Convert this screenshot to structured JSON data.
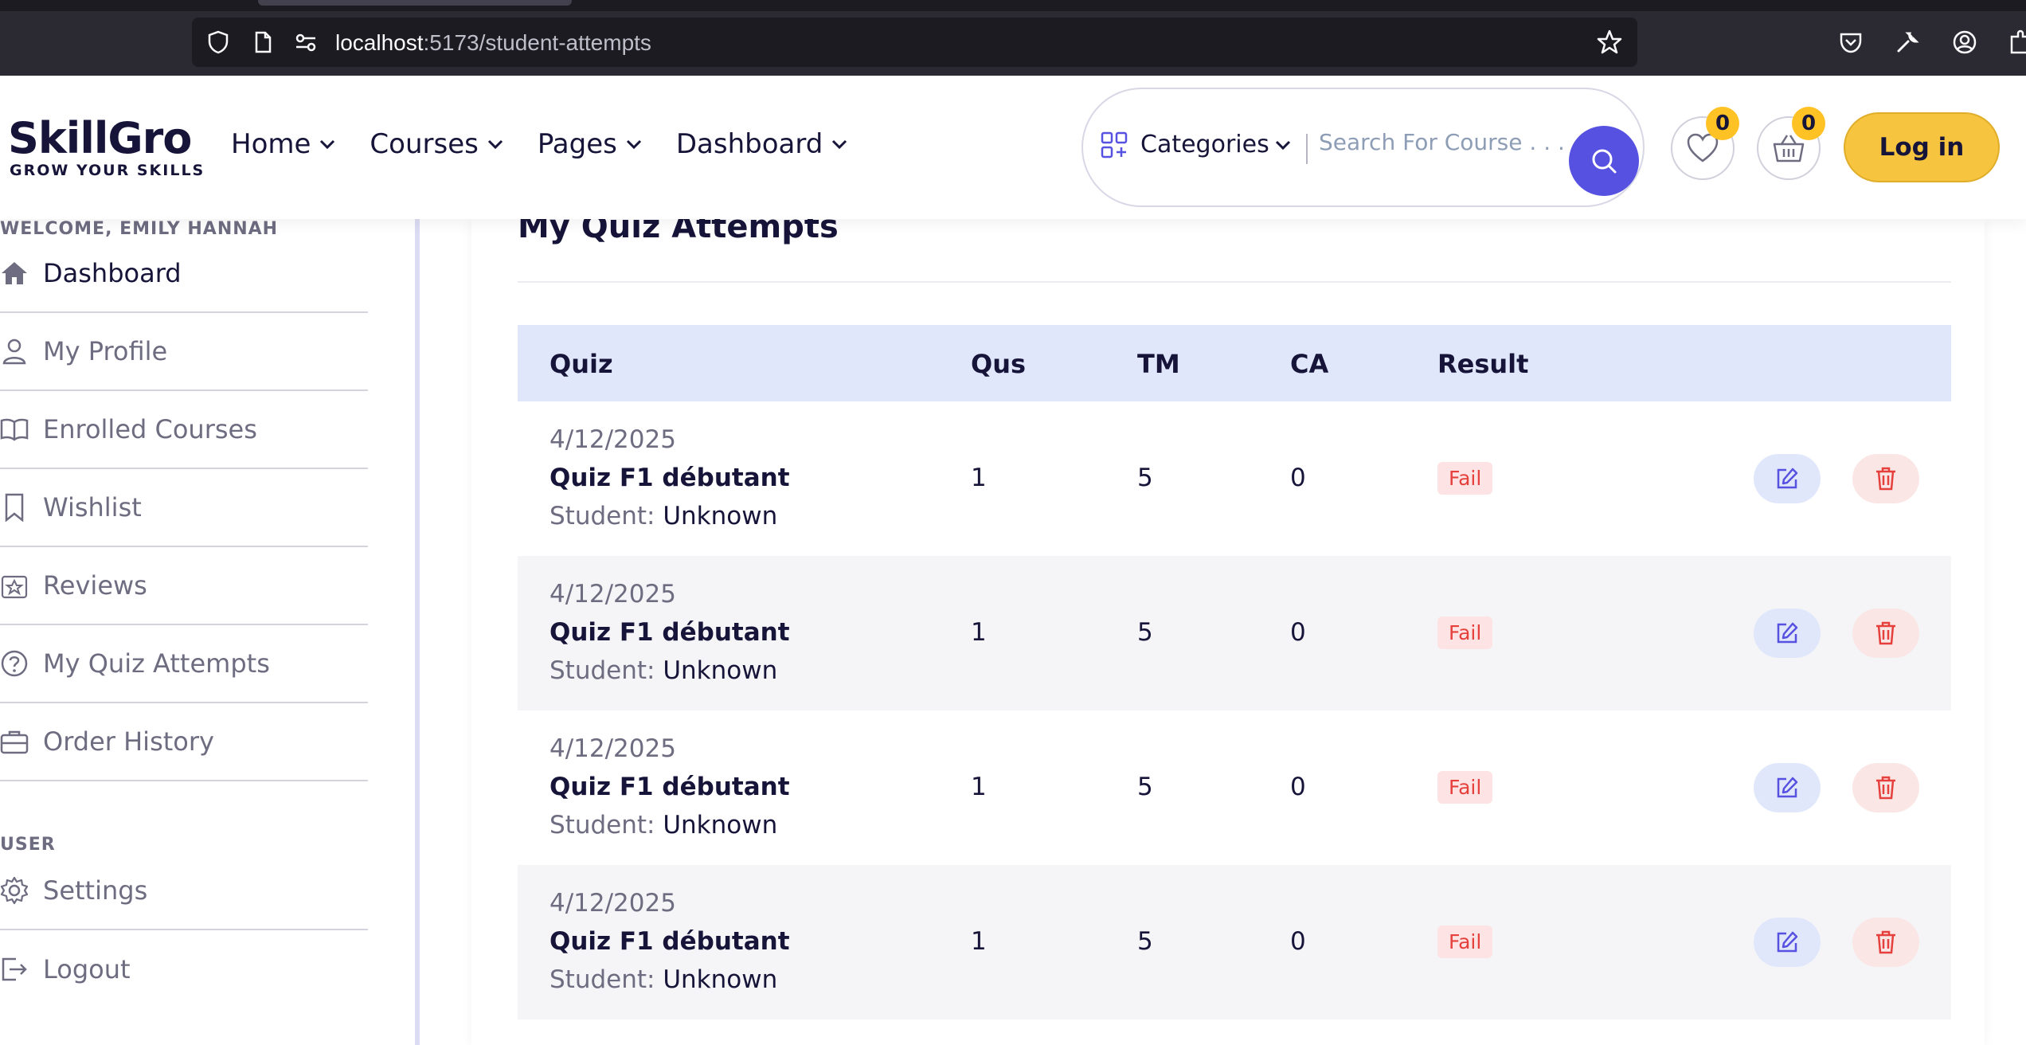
{
  "browser": {
    "url_host": "localhost",
    "url_path": ":5173/student-attempts"
  },
  "header": {
    "logo_text": "SkillGro",
    "logo_tagline": "GROW YOUR SKILLS",
    "nav": [
      {
        "label": "Home"
      },
      {
        "label": "Courses"
      },
      {
        "label": "Pages"
      },
      {
        "label": "Dashboard"
      }
    ],
    "categories_label": "Categories",
    "search_placeholder": "Search For Course . . .",
    "wishlist_count": "0",
    "cart_count": "0",
    "login_label": "Log in",
    "accent_color": "#5751e1",
    "login_color": "#f6c43e"
  },
  "sidebar": {
    "welcome": "WELCOME, EMILY HANNAH",
    "items": [
      {
        "label": "Dashboard",
        "icon": "home-icon"
      },
      {
        "label": "My Profile",
        "icon": "user-icon"
      },
      {
        "label": "Enrolled Courses",
        "icon": "book-icon"
      },
      {
        "label": "Wishlist",
        "icon": "bookmark-icon"
      },
      {
        "label": "Reviews",
        "icon": "star-icon"
      },
      {
        "label": "My Quiz Attempts",
        "icon": "question-icon"
      },
      {
        "label": "Order History",
        "icon": "briefcase-icon"
      }
    ],
    "user_heading": "USER",
    "user_items": [
      {
        "label": "Settings",
        "icon": "gear-icon"
      },
      {
        "label": "Logout",
        "icon": "logout-icon"
      }
    ]
  },
  "main": {
    "title": "My Quiz Attempts",
    "columns": {
      "quiz": "Quiz",
      "qus": "Qus",
      "tm": "TM",
      "ca": "CA",
      "result": "Result"
    },
    "student_label": "Student:",
    "rows": [
      {
        "date": "4/12/2025",
        "quiz": "Quiz F1 débutant",
        "student": "Unknown",
        "qus": "1",
        "tm": "5",
        "ca": "0",
        "result": "Fail"
      },
      {
        "date": "4/12/2025",
        "quiz": "Quiz F1 débutant",
        "student": "Unknown",
        "qus": "1",
        "tm": "5",
        "ca": "0",
        "result": "Fail"
      },
      {
        "date": "4/12/2025",
        "quiz": "Quiz F1 débutant",
        "student": "Unknown",
        "qus": "1",
        "tm": "5",
        "ca": "0",
        "result": "Fail"
      },
      {
        "date": "4/12/2025",
        "quiz": "Quiz F1 débutant",
        "student": "Unknown",
        "qus": "1",
        "tm": "5",
        "ca": "0",
        "result": "Fail"
      }
    ],
    "fail_color": "#e5403c",
    "header_bg": "#e1e7fb"
  }
}
